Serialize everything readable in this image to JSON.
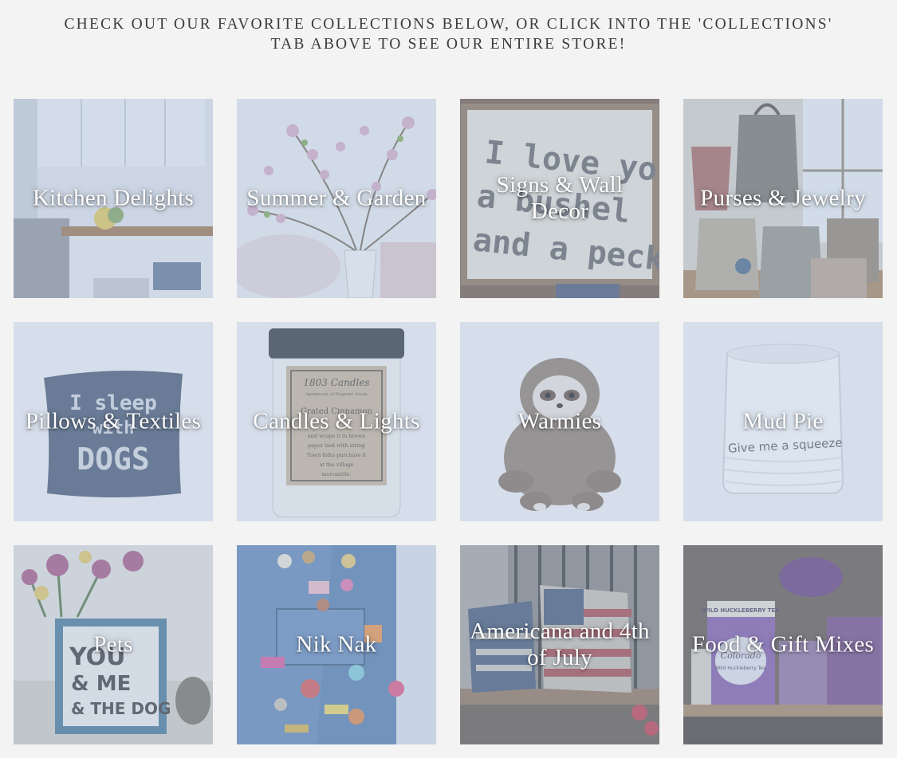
{
  "intro": {
    "line1": "CHECK OUT OUR FAVORITE COLLECTIONS BELOW, OR CLICK INTO THE 'COLLECTIONS'",
    "line2": "TAB ABOVE TO SEE OUR ENTIRE STORE!"
  },
  "collections": [
    {
      "title": "Kitchen Delights",
      "image": "kitchen-photo"
    },
    {
      "title": "Summer & Garden",
      "image": "blossom-vase-photo"
    },
    {
      "title": "Signs & Wall Decor",
      "image": "wood-sign-photo",
      "image_text": [
        "I love you",
        "a bushel",
        "and a peck"
      ]
    },
    {
      "title": "Purses & Jewelry",
      "image": "purses-photo"
    },
    {
      "title": "Pillows & Textiles",
      "image": "denim-pillow-photo",
      "image_text": [
        "I sleep",
        "with",
        "DOGS"
      ]
    },
    {
      "title": "Candles & Lights",
      "image": "candle-jar-photo",
      "image_text": [
        "1803 Candles",
        "Apothecary of Fragrant Goods",
        "Grated Cinnamon",
        "and wraps it in brown",
        "paper tied with string",
        "Town folks purchase it",
        "at the village",
        "mercantile."
      ]
    },
    {
      "title": "Warmies",
      "image": "plush-sloth-photo"
    },
    {
      "title": "Mud Pie",
      "image": "white-cup-photo",
      "image_text": [
        "Give me a squeeze"
      ]
    },
    {
      "title": "Pets",
      "image": "pet-frame-photo",
      "image_text": [
        "YOU",
        "& ME",
        "& THE DOG"
      ]
    },
    {
      "title": "Nik Nak",
      "image": "denim-pins-photo"
    },
    {
      "title": "Americana and 4th of July",
      "image": "flag-pillow-bench-photo"
    },
    {
      "title": "Food & Gift Mixes",
      "image": "huckleberry-shelf-photo",
      "image_text": [
        "WILD HUCKLEBERRY TEA",
        "Colorado",
        "Wild Huckleberry Tea"
      ]
    }
  ]
}
